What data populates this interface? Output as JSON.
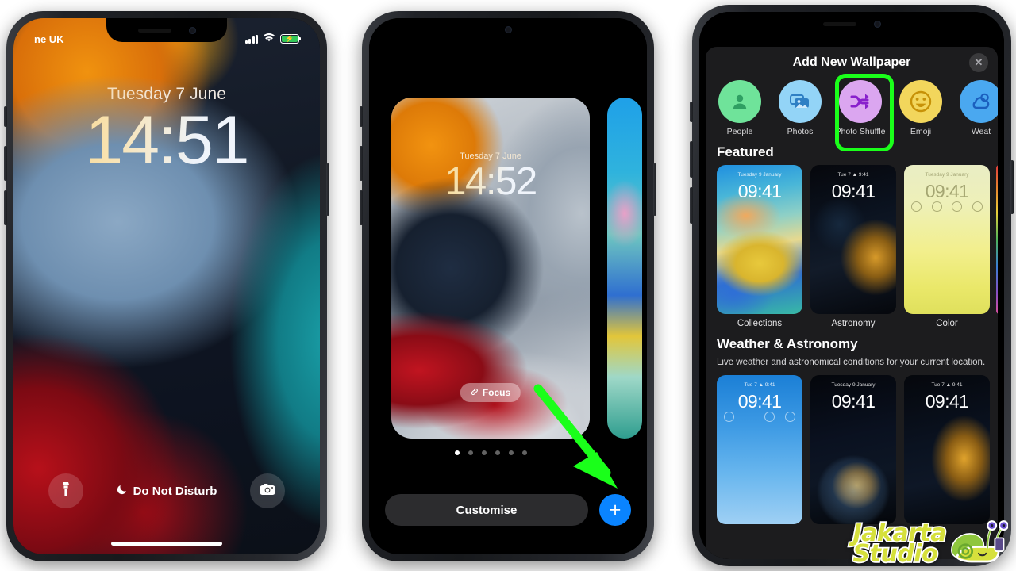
{
  "phone1": {
    "name": "iphone-lockscreen",
    "statusbar": {
      "carrier": "ne UK",
      "signal_icon": "cellular-bars-icon",
      "wifi_icon": "wifi-icon",
      "battery_icon": "battery-charging-icon"
    },
    "lock": {
      "date": "Tuesday 7 June",
      "time": "14:51"
    },
    "bottom": {
      "flashlight_icon": "flashlight-icon",
      "focus_label": "Do Not Disturb",
      "focus_icon": "moon-icon",
      "camera_icon": "camera-icon"
    }
  },
  "phone2": {
    "name": "iphone-wallpaper-gallery",
    "card": {
      "date": "Tuesday 7 June",
      "time": "14:52",
      "focus_label": "Focus",
      "focus_icon": "focus-link-icon"
    },
    "page_dots": {
      "count": 6,
      "active_index": 0
    },
    "customise_label": "Customise",
    "plus_label": "+",
    "annotation": {
      "arrow_icon": "green-arrow-icon",
      "arrow_color": "#1aff1a"
    }
  },
  "phone3": {
    "name": "add-new-wallpaper-sheet",
    "sheet_title": "Add New Wallpaper",
    "close_label": "✕",
    "highlight_color": "#1aff1a",
    "categories": [
      {
        "label": "People",
        "icon": "person-icon",
        "bubble_color": "#6fe39a",
        "glyph_color": "#2f9f63",
        "highlighted": false
      },
      {
        "label": "Photos",
        "icon": "photo-stack-icon",
        "bubble_color": "#93d4f7",
        "glyph_color": "#2f7fc4",
        "highlighted": false
      },
      {
        "label": "Photo Shuffle",
        "icon": "shuffle-icon",
        "bubble_color": "#dba6f0",
        "glyph_color": "#8820cc",
        "highlighted": true
      },
      {
        "label": "Emoji",
        "icon": "smiley-icon",
        "bubble_color": "#f2d65c",
        "glyph_color": "#c79208",
        "highlighted": false
      },
      {
        "label": "Weat",
        "icon": "weather-cloud-icon",
        "bubble_color": "#4aa8f0",
        "glyph_color": "#1b5fbe",
        "highlighted": false
      }
    ],
    "featured": {
      "title": "Featured",
      "items": [
        {
          "caption": "Collections",
          "time": "09:41",
          "date": "Tuesday 9 January",
          "style": "wp-collections"
        },
        {
          "caption": "Astronomy",
          "time": "09:41",
          "date": "Tue 7  ▲  9:41",
          "style": "wp-astronomy"
        },
        {
          "caption": "Color",
          "time": "09:41",
          "date": "Tuesday 9 January",
          "style": "wp-color"
        }
      ]
    },
    "weather_astronomy": {
      "title": "Weather & Astronomy",
      "subtitle": "Live weather and astronomical conditions for your current location.",
      "items": [
        {
          "caption": "",
          "time": "09:41",
          "date": "Tue 7  ▲  9:41",
          "style": "wp-weather"
        },
        {
          "caption": "",
          "time": "09:41",
          "date": "Tuesday 9 January",
          "style": "wp-earth"
        },
        {
          "caption": "",
          "time": "09:41",
          "date": "Tue 7  ▲  9:41",
          "style": "wp-earth2"
        }
      ]
    }
  },
  "watermark": {
    "line1": "Jakarta",
    "line2": "Studio",
    "mascot_icon": "snail-mascot-icon",
    "text_color": "#d6e03c"
  }
}
